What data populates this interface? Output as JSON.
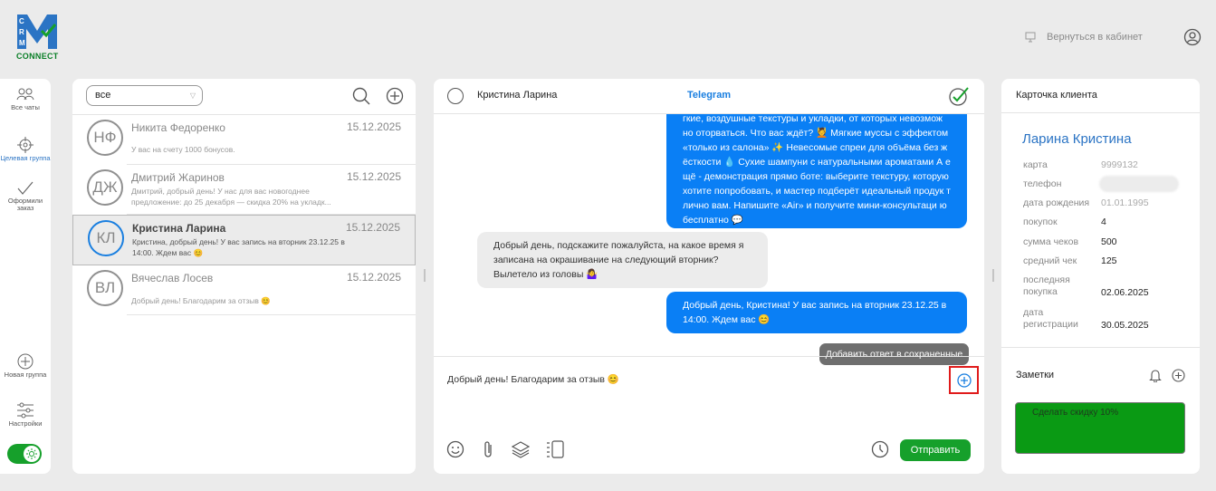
{
  "brand": {
    "logo_letters": "CRM",
    "logo_text": "CONNECT",
    "colors": {
      "blue": "#2b74c4",
      "green": "#0a7f27"
    }
  },
  "header": {
    "back_label": "Вернуться в кабинет",
    "back_icon": "cabinet-icon",
    "profile_icon": "user-circle-icon"
  },
  "rail": {
    "items": [
      {
        "label": "Все чаты",
        "icon": "people-icon"
      },
      {
        "label": "Целевая группа",
        "icon": "target-icon"
      },
      {
        "label": "Оформили заказ",
        "icon": "check-icon"
      },
      {
        "label": "Новая группа",
        "icon": "plus-circle-icon"
      },
      {
        "label": "Настройки",
        "icon": "sliders-icon"
      }
    ],
    "theme_toggle": "on"
  },
  "chat_list": {
    "filter_value": "все",
    "chats": [
      {
        "initials": "НФ",
        "name": "Никита Федоренко",
        "date": "15.12.2025",
        "preview": "У вас на счету 1000 бонусов."
      },
      {
        "initials": "ДЖ",
        "name": "Дмитрий Жаринов",
        "date": "15.12.2025",
        "preview": "Дмитрий, добрый день! У нас для вас новогоднее предложение: до 25 декабря — скидка 20% на укладк..."
      },
      {
        "initials": "КЛ",
        "name": "Кристина Ларина",
        "date": "15.12.2025",
        "preview": "Кристина, добрый день! У вас запись на вторник 23.12.25 в 14:00. Ждем вас 😊",
        "selected": true
      },
      {
        "initials": "ВЛ",
        "name": "Вячеслав Лосев",
        "date": "15.12.2025",
        "preview": "Добрый день! Благодарим за отзыв 😊"
      }
    ]
  },
  "conversation": {
    "contact": "Кристина Ларина",
    "channel": "Telegram",
    "messages": [
      {
        "dir": "out",
        "text": "гкие, воздушные текстуры и укладки, от которых невозмож но оторваться. Что вас ждёт? 💆 Мягкие муссы с эффектом «только из салона» ✨ Невесомые спреи для объёма без ж ёсткости 💧 Сухие шампуни с натуральными ароматами А е щё - демонстрация прямо боте: выберите текстуру, которую хотите попробовать, и мастер подберёт идеальный продук т лично вам. Напишите «Air» и получите мини-консультаци ю бесплатно 💬"
      },
      {
        "dir": "in",
        "text": "Добрый день, подскажите пожалуйста, на какое время я записана на окрашивание на следующий вторник? Вылетело из головы 🤷‍♀️"
      },
      {
        "dir": "out",
        "text": "Добрый день, Кристина! У вас запись на вторник 23.12.25 в 14:00. Ждем вас 😊"
      }
    ],
    "tooltip": "Добавить ответ в сохраненные",
    "draft": "Добрый день! Благодарим за отзыв 😊",
    "send_label": "Отправить"
  },
  "client_card": {
    "title": "Карточка клиента",
    "name": "Ларина Кристина",
    "fields": [
      {
        "label": "карта",
        "value": "9999132",
        "muted": true
      },
      {
        "label": "телефон",
        "value": ""
      },
      {
        "label": "дата рождения",
        "value": "01.01.1995",
        "muted": true
      },
      {
        "label": "покупок",
        "value": "4"
      },
      {
        "label": "сумма чеков",
        "value": "500"
      },
      {
        "label": "средний чек",
        "value": "125"
      },
      {
        "label": "последняя покупка",
        "value": "02.06.2025"
      },
      {
        "label": "дата регистрации",
        "value": "30.05.2025"
      }
    ],
    "notes_title": "Заметки",
    "note_text": "Сделать скидку 10%",
    "note_color": "#0a9a14"
  }
}
